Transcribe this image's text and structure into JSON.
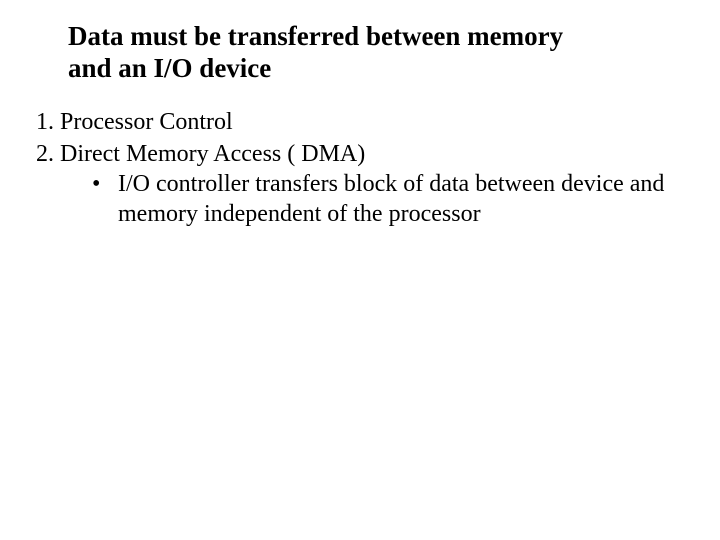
{
  "title": "Data must be transferred between memory and an I/O device",
  "items": [
    {
      "text": "Processor Control"
    },
    {
      "text": "Direct Memory Access ( DMA)",
      "sub": [
        "I/O controller transfers block of data between device and memory independent of the processor"
      ]
    }
  ]
}
